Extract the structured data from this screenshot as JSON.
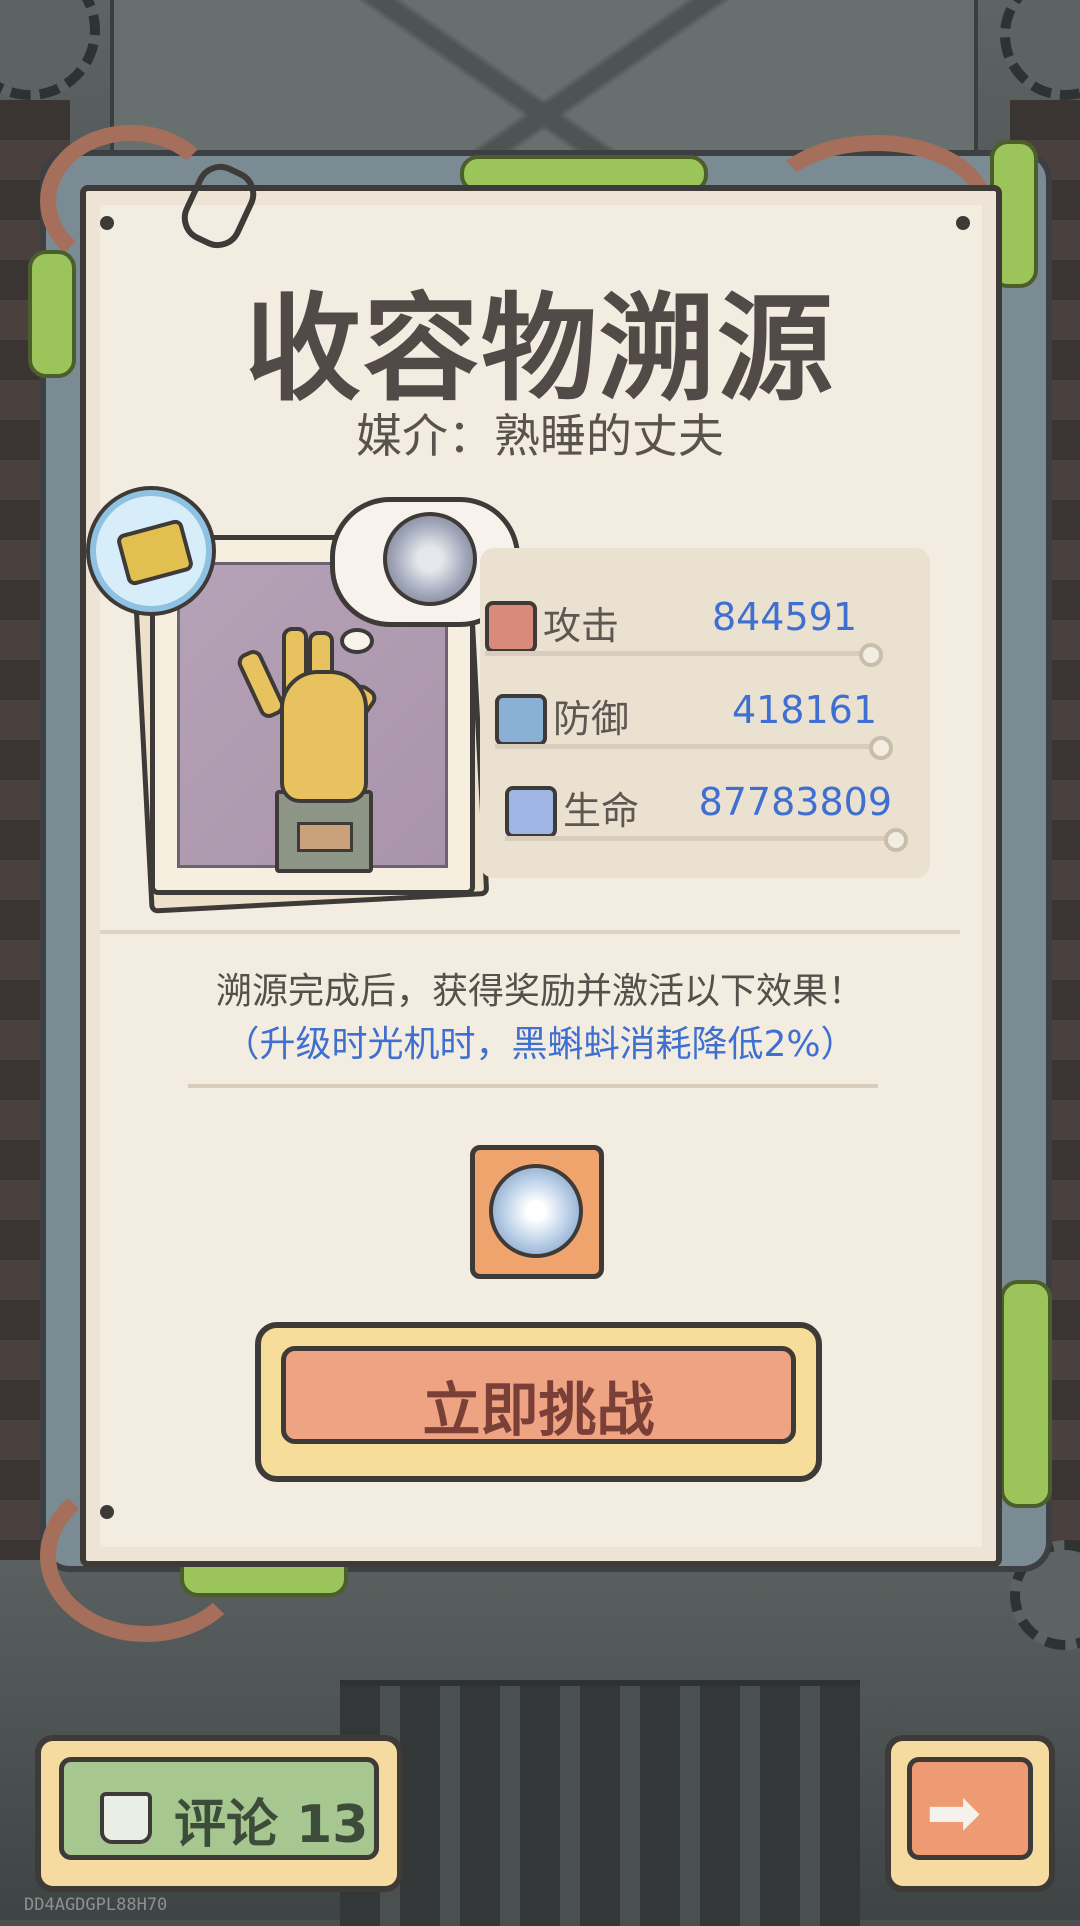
{
  "header": {
    "title": "收容物溯源",
    "subtitle": "媒介：熟睡的丈夫"
  },
  "stats": [
    {
      "icon": "attack-icon",
      "label": "攻击",
      "value": "844591"
    },
    {
      "icon": "defense-icon",
      "label": "防御",
      "value": "418161"
    },
    {
      "icon": "health-icon",
      "label": "生命",
      "value": "87783809"
    }
  ],
  "effect": {
    "description": "溯源完成后，获得奖励并激活以下效果！",
    "bonus": "（升级时光机时，黑蝌蚪消耗降低2%）"
  },
  "reward": {
    "icon": "time-orb-icon"
  },
  "buttons": {
    "challenge": "立即挑战",
    "comment": "评论 13",
    "next_icon": "arrow-right-icon"
  },
  "watermark": "DD4AGDGPL88H70",
  "colors": {
    "stat_value": "#3f6fd0",
    "bonus_text": "#3f6fd0",
    "challenge_button": "#eea382",
    "comment_button": "#a6c78f",
    "next_button": "#ee9a72"
  }
}
